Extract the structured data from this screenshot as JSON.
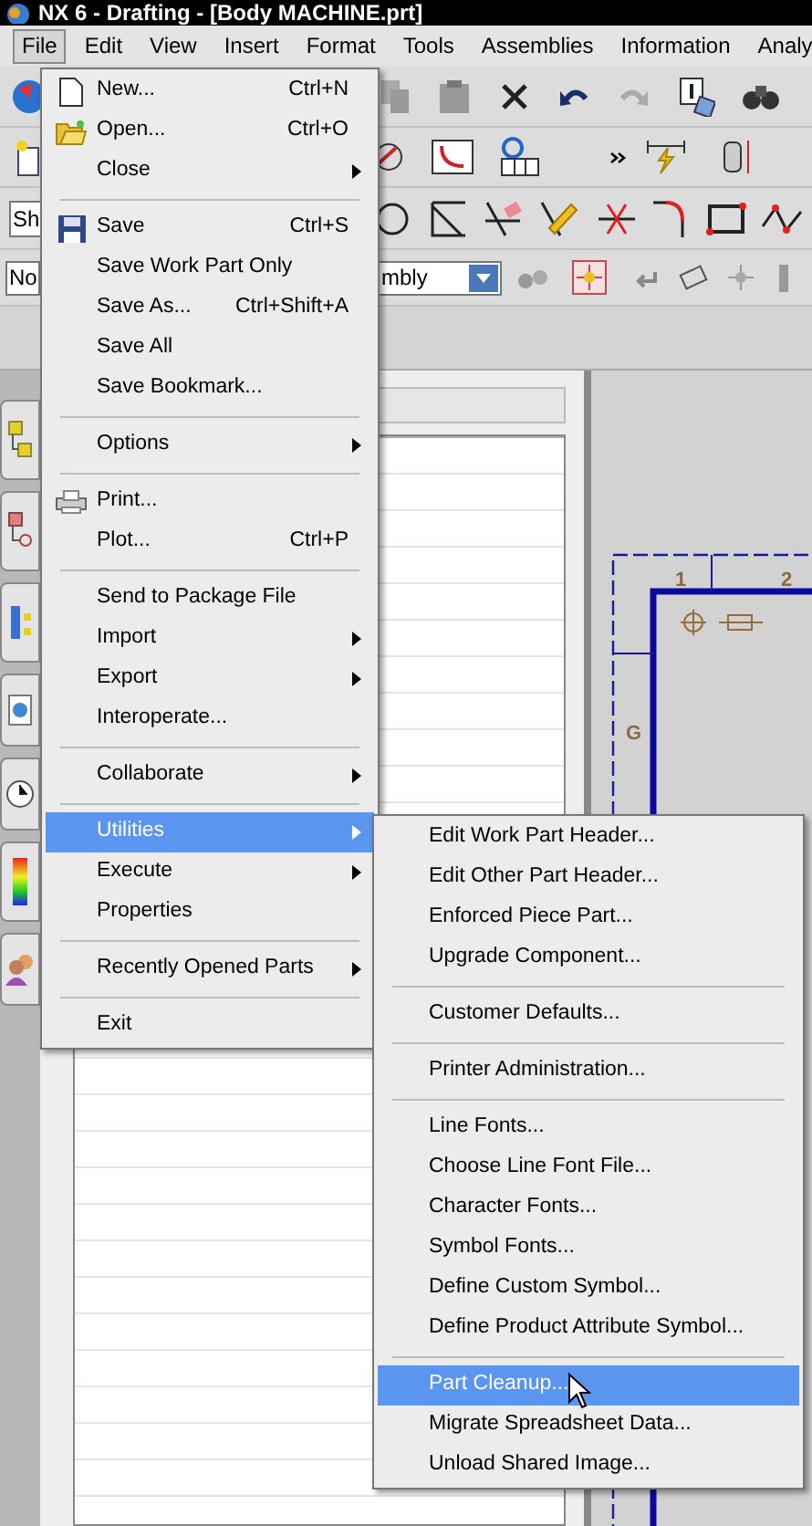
{
  "window": {
    "title": "NX 6 - Drafting - [Body MACHINE.prt]"
  },
  "menubar": [
    {
      "label": "File",
      "selected": true
    },
    {
      "label": "Edit",
      "selected": false
    },
    {
      "label": "View",
      "selected": false
    },
    {
      "label": "Insert",
      "selected": false
    },
    {
      "label": "Format",
      "selected": false
    },
    {
      "label": "Tools",
      "selected": false
    },
    {
      "label": "Assemblies",
      "selected": false
    },
    {
      "label": "Information",
      "selected": false
    },
    {
      "label": "Analy",
      "selected": false
    }
  ],
  "toolbar": {
    "sheet_field": "Sh",
    "filter_combo": "No",
    "assembly_combo": "mbly"
  },
  "file_menu": [
    {
      "kind": "item",
      "label": "New...",
      "shortcut": "Ctrl+N",
      "submenu": false,
      "selected": false
    },
    {
      "kind": "item",
      "label": "Open...",
      "shortcut": "Ctrl+O",
      "submenu": false,
      "selected": false
    },
    {
      "kind": "item",
      "label": "Close",
      "submenu": true,
      "selected": false
    },
    {
      "kind": "separator"
    },
    {
      "kind": "item",
      "label": "Save",
      "shortcut": "Ctrl+S",
      "submenu": false,
      "selected": false
    },
    {
      "kind": "item",
      "label": "Save Work Part Only",
      "submenu": false,
      "selected": false
    },
    {
      "kind": "item",
      "label": "Save As...",
      "shortcut": "Ctrl+Shift+A",
      "submenu": false,
      "selected": false
    },
    {
      "kind": "item",
      "label": "Save All",
      "submenu": false,
      "selected": false
    },
    {
      "kind": "item",
      "label": "Save Bookmark...",
      "submenu": false,
      "selected": false
    },
    {
      "kind": "separator"
    },
    {
      "kind": "item",
      "label": "Options",
      "submenu": true,
      "selected": false
    },
    {
      "kind": "separator"
    },
    {
      "kind": "item",
      "label": "Print...",
      "submenu": false,
      "selected": false
    },
    {
      "kind": "item",
      "label": "Plot...",
      "shortcut": "Ctrl+P",
      "submenu": false,
      "selected": false
    },
    {
      "kind": "separator"
    },
    {
      "kind": "item",
      "label": "Send to Package File",
      "submenu": false,
      "selected": false
    },
    {
      "kind": "item",
      "label": "Import",
      "submenu": true,
      "selected": false
    },
    {
      "kind": "item",
      "label": "Export",
      "submenu": true,
      "selected": false
    },
    {
      "kind": "item",
      "label": "Interoperate...",
      "submenu": false,
      "selected": false
    },
    {
      "kind": "separator"
    },
    {
      "kind": "item",
      "label": "Collaborate",
      "submenu": true,
      "selected": false
    },
    {
      "kind": "separator"
    },
    {
      "kind": "item",
      "label": "Utilities",
      "submenu": true,
      "selected": true
    },
    {
      "kind": "item",
      "label": "Execute",
      "submenu": true,
      "selected": false
    },
    {
      "kind": "item",
      "label": "Properties",
      "submenu": false,
      "selected": false
    },
    {
      "kind": "separator"
    },
    {
      "kind": "item",
      "label": "Recently Opened Parts",
      "submenu": true,
      "selected": false
    },
    {
      "kind": "separator"
    },
    {
      "kind": "item",
      "label": "Exit",
      "submenu": false,
      "selected": false
    }
  ],
  "utilities_submenu": [
    {
      "kind": "item",
      "label": "Edit Work Part Header...",
      "selected": false
    },
    {
      "kind": "item",
      "label": "Edit Other Part Header...",
      "selected": false
    },
    {
      "kind": "item",
      "label": "Enforced Piece Part...",
      "selected": false
    },
    {
      "kind": "item",
      "label": "Upgrade Component...",
      "selected": false
    },
    {
      "kind": "separator"
    },
    {
      "kind": "item",
      "label": "Customer Defaults...",
      "selected": false
    },
    {
      "kind": "separator"
    },
    {
      "kind": "item",
      "label": "Printer Administration...",
      "selected": false
    },
    {
      "kind": "separator"
    },
    {
      "kind": "item",
      "label": "Line Fonts...",
      "selected": false
    },
    {
      "kind": "item",
      "label": "Choose Line Font File...",
      "selected": false
    },
    {
      "kind": "item",
      "label": "Character Fonts...",
      "selected": false
    },
    {
      "kind": "item",
      "label": "Symbol Fonts...",
      "selected": false
    },
    {
      "kind": "item",
      "label": "Define Custom Symbol...",
      "selected": false
    },
    {
      "kind": "item",
      "label": "Define Product Attribute Symbol...",
      "selected": false
    },
    {
      "kind": "separator"
    },
    {
      "kind": "item",
      "label": "Part Cleanup...",
      "selected": true
    },
    {
      "kind": "item",
      "label": "Migrate Spreadsheet Data...",
      "selected": false
    },
    {
      "kind": "item",
      "label": "Unload Shared Image...",
      "selected": false
    }
  ],
  "drawing": {
    "zone_labels": [
      "1",
      "2",
      "G"
    ]
  }
}
